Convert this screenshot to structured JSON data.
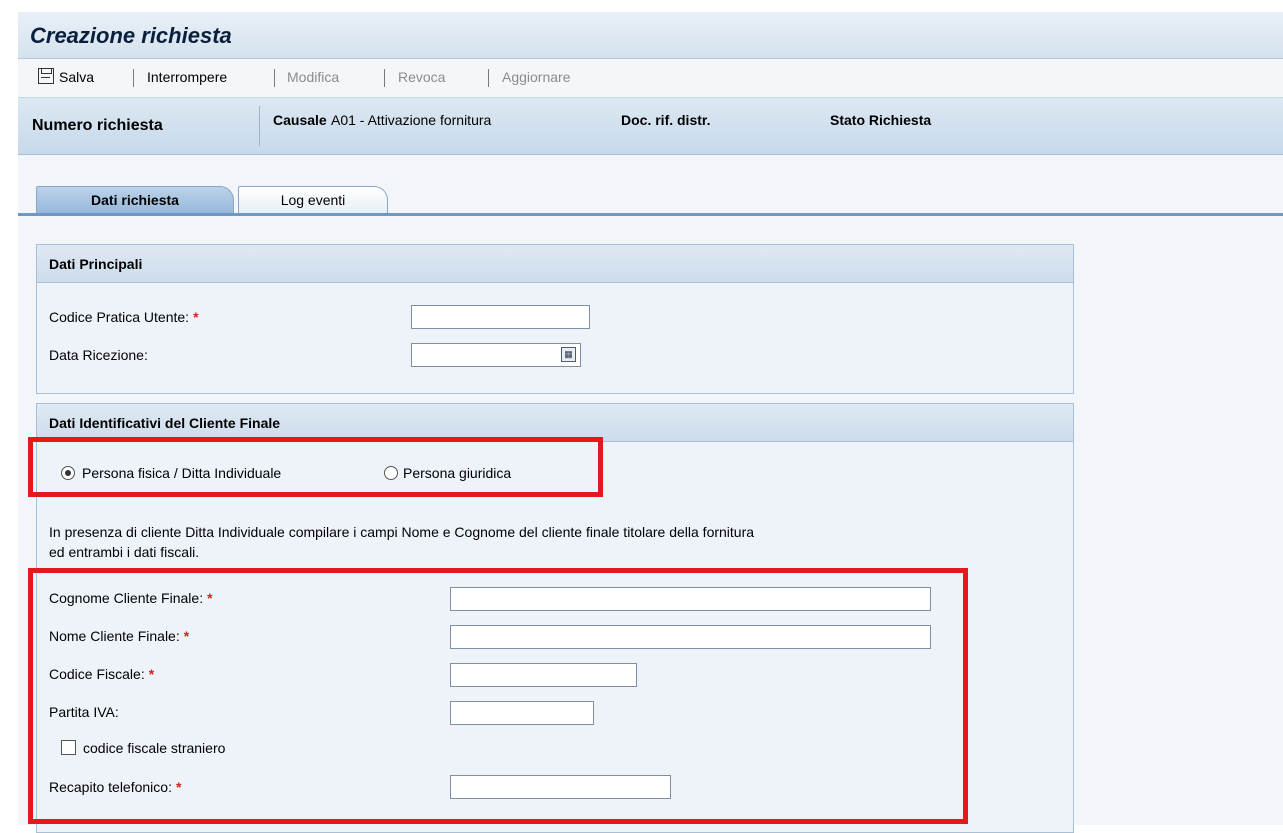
{
  "window": {
    "title": "Creazione richiesta"
  },
  "toolbar": {
    "save": "Salva",
    "interrupt": "Interrompere",
    "edit": "Modifica",
    "revoke": "Revoca",
    "update": "Aggiornare"
  },
  "header": {
    "request_number": "Numero richiesta",
    "causale_label": "Causale",
    "causale_value": "A01 - Attivazione fornitura",
    "doc_rif": "Doc. rif. distr.",
    "status": "Stato Richiesta"
  },
  "tabs": [
    {
      "label": "Dati richiesta",
      "active": true
    },
    {
      "label": "Log eventi",
      "active": false
    }
  ],
  "main_section": {
    "title": "Dati Principali",
    "fields": [
      {
        "label": "Codice Pratica Utente:",
        "required": "*",
        "value": ""
      },
      {
        "label": "Data Ricezione:",
        "value": ""
      }
    ]
  },
  "client_section": {
    "title": "Dati Identificativi del Cliente Finale",
    "radio_options": [
      {
        "label": "Persona fisica / Ditta Individuale",
        "checked": true
      },
      {
        "label": "Persona giuridica",
        "checked": false
      }
    ],
    "hint_line1": "In presenza di cliente Ditta Individuale compilare i campi Nome e Cognome del cliente finale titolare della fornitura",
    "hint_line2": "ed entrambi i dati fiscali.",
    "fields": [
      {
        "label": "Cognome Cliente Finale:",
        "required": "*",
        "value": ""
      },
      {
        "label": "Nome Cliente Finale:",
        "required": "*",
        "value": ""
      },
      {
        "label": "Codice Fiscale:",
        "required": "*",
        "value": ""
      },
      {
        "label": "Partita IVA:",
        "value": ""
      },
      {
        "label": "Recapito telefonico:",
        "required": "*",
        "value": ""
      }
    ],
    "checkbox": {
      "label": "codice fiscale straniero",
      "checked": false
    }
  },
  "colors": {
    "highlight": "#e3191e",
    "required": "#d32020",
    "title_bar": "#d5e2ee",
    "active_tab": "#95b7da"
  },
  "icons": [
    "save-icon",
    "calendar-icon"
  ]
}
